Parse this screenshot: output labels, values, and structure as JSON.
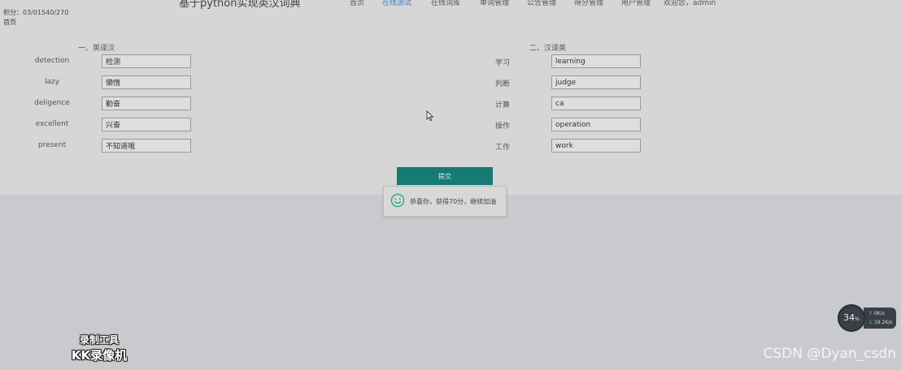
{
  "header": {
    "title": "基于python实现英汉词典",
    "nav": [
      {
        "label": "首页",
        "active": false
      },
      {
        "label": "在线测试",
        "active": true
      },
      {
        "label": "在线词库",
        "active": false
      },
      {
        "label": "单词管理",
        "active": false
      },
      {
        "label": "公告管理",
        "active": false
      },
      {
        "label": "得分管理",
        "active": false
      },
      {
        "label": "用户管理",
        "active": false
      }
    ],
    "welcome": "欢迎您，admin"
  },
  "status": {
    "line1": "积分：03/01540/270",
    "line2": "首页"
  },
  "quiz": {
    "en_to_zh": {
      "title": "一、英译汉",
      "rows": [
        {
          "word": "detection",
          "answer": "检测"
        },
        {
          "word": "lazy",
          "answer": "懒惰"
        },
        {
          "word": "deligence",
          "answer": "勤奋"
        },
        {
          "word": "excellent",
          "answer": "兴奋"
        },
        {
          "word": "present",
          "answer": "不知道哦"
        }
      ]
    },
    "zh_to_en": {
      "title": "二、汉译英",
      "rows": [
        {
          "word": "学习",
          "answer": "learning"
        },
        {
          "word": "判断",
          "answer": "judge"
        },
        {
          "word": "计算",
          "answer": "ca"
        },
        {
          "word": "操作",
          "answer": "operation"
        },
        {
          "word": "工作",
          "answer": "work"
        }
      ]
    },
    "submit_label": "提交",
    "result_message": "恭喜你，获得70分，继续加油"
  },
  "overlay": {
    "recorder_line1": "录制工具",
    "recorder_line2": "KK录像机",
    "csdn_watermark": "CSDN @Dyan_csdn",
    "perf_percent": "34",
    "perf_percent_unit": "%",
    "upload_speed": "0",
    "upload_unit": "K/s",
    "download_speed": "19.2",
    "download_unit": "K/s"
  },
  "colors": {
    "accent": "#167a75",
    "nav_active": "#3b7fc4",
    "smile": "#2aa58a"
  },
  "icons": [
    "smile-icon",
    "mouse-cursor-icon"
  ]
}
